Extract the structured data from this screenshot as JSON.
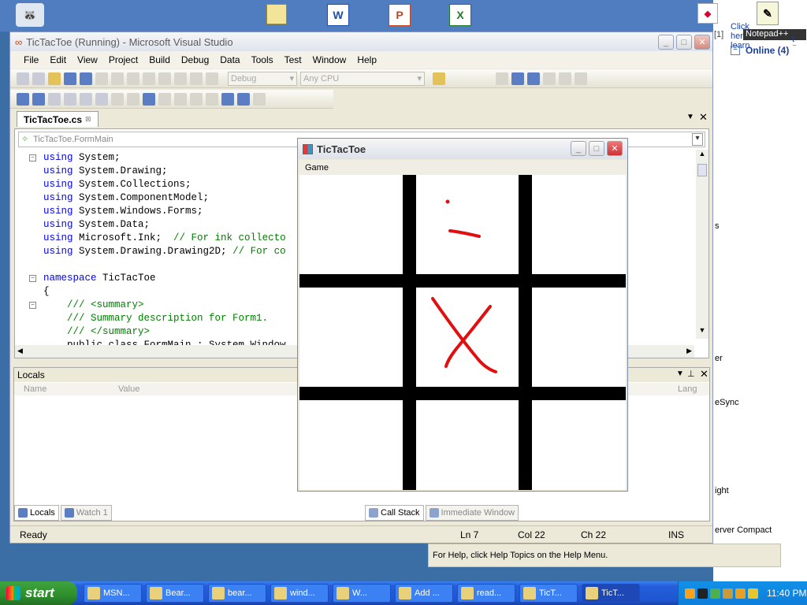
{
  "desktop": {
    "right_pane": {
      "tooltip": "Notepad++",
      "online": "Online (4)",
      "link_text": "Click here to learn",
      "link_text_2": "t Pro",
      "frag_1": "s",
      "frag_2": "er",
      "frag_3": "eSync",
      "frag_4": "ight",
      "frag_5": "erver Compact",
      "counter": "[1]"
    }
  },
  "vs": {
    "title": "TicTacToe (Running) - Microsoft Visual Studio",
    "menu": [
      "File",
      "Edit",
      "View",
      "Project",
      "Build",
      "Debug",
      "Data",
      "Tools",
      "Test",
      "Window",
      "Help"
    ],
    "toolbar": {
      "config": "Debug",
      "platform": "Any CPU"
    },
    "doc_tab": "TicTacToe.cs",
    "nav_class": "TicTacToe.FormMain",
    "code": [
      {
        "kw": "using",
        "rest": " System;",
        "cm": ""
      },
      {
        "kw": "using",
        "rest": " System.Drawing;",
        "cm": ""
      },
      {
        "kw": "using",
        "rest": " System.Collections;",
        "cm": ""
      },
      {
        "kw": "using",
        "rest": " System.ComponentModel;",
        "cm": ""
      },
      {
        "kw": "using",
        "rest": " System.Windows.Forms;",
        "cm": ""
      },
      {
        "kw": "using",
        "rest": " System.Data;",
        "cm": ""
      },
      {
        "kw": "using",
        "rest": " Microsoft.Ink;  ",
        "cm": "// For ink collecto"
      },
      {
        "kw": "using",
        "rest": " System.Drawing.Drawing2D; ",
        "cm": "// For co"
      },
      {
        "kw": "",
        "rest": "",
        "cm": ""
      },
      {
        "kw": "namespace",
        "rest": " TicTacToe",
        "cm": ""
      },
      {
        "kw": "",
        "rest": "{",
        "cm": ""
      },
      {
        "kw": "",
        "rest": "    ",
        "cm": "/// <summary>"
      },
      {
        "kw": "",
        "rest": "    ",
        "cm": "/// Summary description for Form1."
      },
      {
        "kw": "",
        "rest": "    ",
        "cm": "/// </summary>"
      },
      {
        "kw": "",
        "rest": "    public class FormMain : System.Window",
        "cm": ""
      }
    ],
    "locals": {
      "title": "Locals",
      "col_name": "Name",
      "col_value": "Value",
      "col_lang": "Lang"
    },
    "bottom_tabs_left": [
      "Locals",
      "Watch 1"
    ],
    "bottom_tabs_right": [
      "Call Stack",
      "Immediate Window"
    ],
    "status": {
      "text": "Ready",
      "ln": "Ln 7",
      "col": "Col 22",
      "ch": "Ch 22",
      "mode": "INS"
    }
  },
  "game": {
    "title": "TicTacToe",
    "menu": "Game"
  },
  "help_text": "For Help, click Help Topics on the Help Menu.",
  "taskbar": {
    "start": "start",
    "tasks": [
      "MSN...",
      "Bear...",
      "bear...",
      "wind...",
      "W...",
      "Add ...",
      "read...",
      "TicT...",
      "TicT..."
    ],
    "clock": "11:40 PM"
  },
  "colors": {
    "ink": "#e01010",
    "taskbar": "#245edb",
    "start": "#2d8f2d"
  }
}
